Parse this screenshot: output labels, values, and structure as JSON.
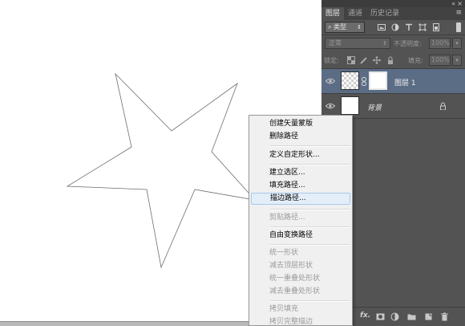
{
  "panel": {
    "collapse_glyph": "«",
    "close_glyph": "×",
    "tabs": [
      "图层",
      "通道",
      "历史记录"
    ],
    "menu_glyph": "≡",
    "filter": {
      "kind": "类型",
      "icons": [
        "image-filter-icon",
        "adjustment-filter-icon",
        "type-filter-icon",
        "shape-filter-icon",
        "smart-object-filter-icon"
      ]
    },
    "blend_mode": "正常",
    "opacity_label": "不透明度:",
    "opacity_value": "100%",
    "lock_label": "锁定:",
    "fill_label": "填充:",
    "fill_value": "100%",
    "layers": [
      {
        "name": "图层 1",
        "selected": true,
        "has_mask": true
      },
      {
        "name": "背景",
        "selected": false,
        "locked": true
      }
    ],
    "footer_fx": "fx."
  },
  "context_menu": {
    "items": [
      {
        "label": "创建矢量蒙版",
        "enabled": true
      },
      {
        "label": "删除路径",
        "enabled": true
      },
      {
        "label": "定义自定形状...",
        "enabled": true
      },
      {
        "label": "建立选区...",
        "enabled": true
      },
      {
        "label": "填充路径...",
        "enabled": true
      },
      {
        "label": "描边路径...",
        "enabled": true,
        "highlighted": true
      },
      {
        "label": "剪贴路径...",
        "enabled": false
      },
      {
        "label": "自由变换路径",
        "enabled": true
      },
      {
        "label": "统一形状",
        "enabled": false
      },
      {
        "label": "减去顶层形状",
        "enabled": false
      },
      {
        "label": "统一重叠处形状",
        "enabled": false
      },
      {
        "label": "减去重叠处形状",
        "enabled": false
      },
      {
        "label": "拷贝填充",
        "enabled": false
      },
      {
        "label": "拷贝完整描边",
        "enabled": false
      }
    ]
  },
  "colors": {
    "panel_bg": "#535353",
    "selected_layer": "#5b6c85",
    "menu_bg": "#f0f0f0",
    "menu_highlight": "#e4eef9"
  }
}
